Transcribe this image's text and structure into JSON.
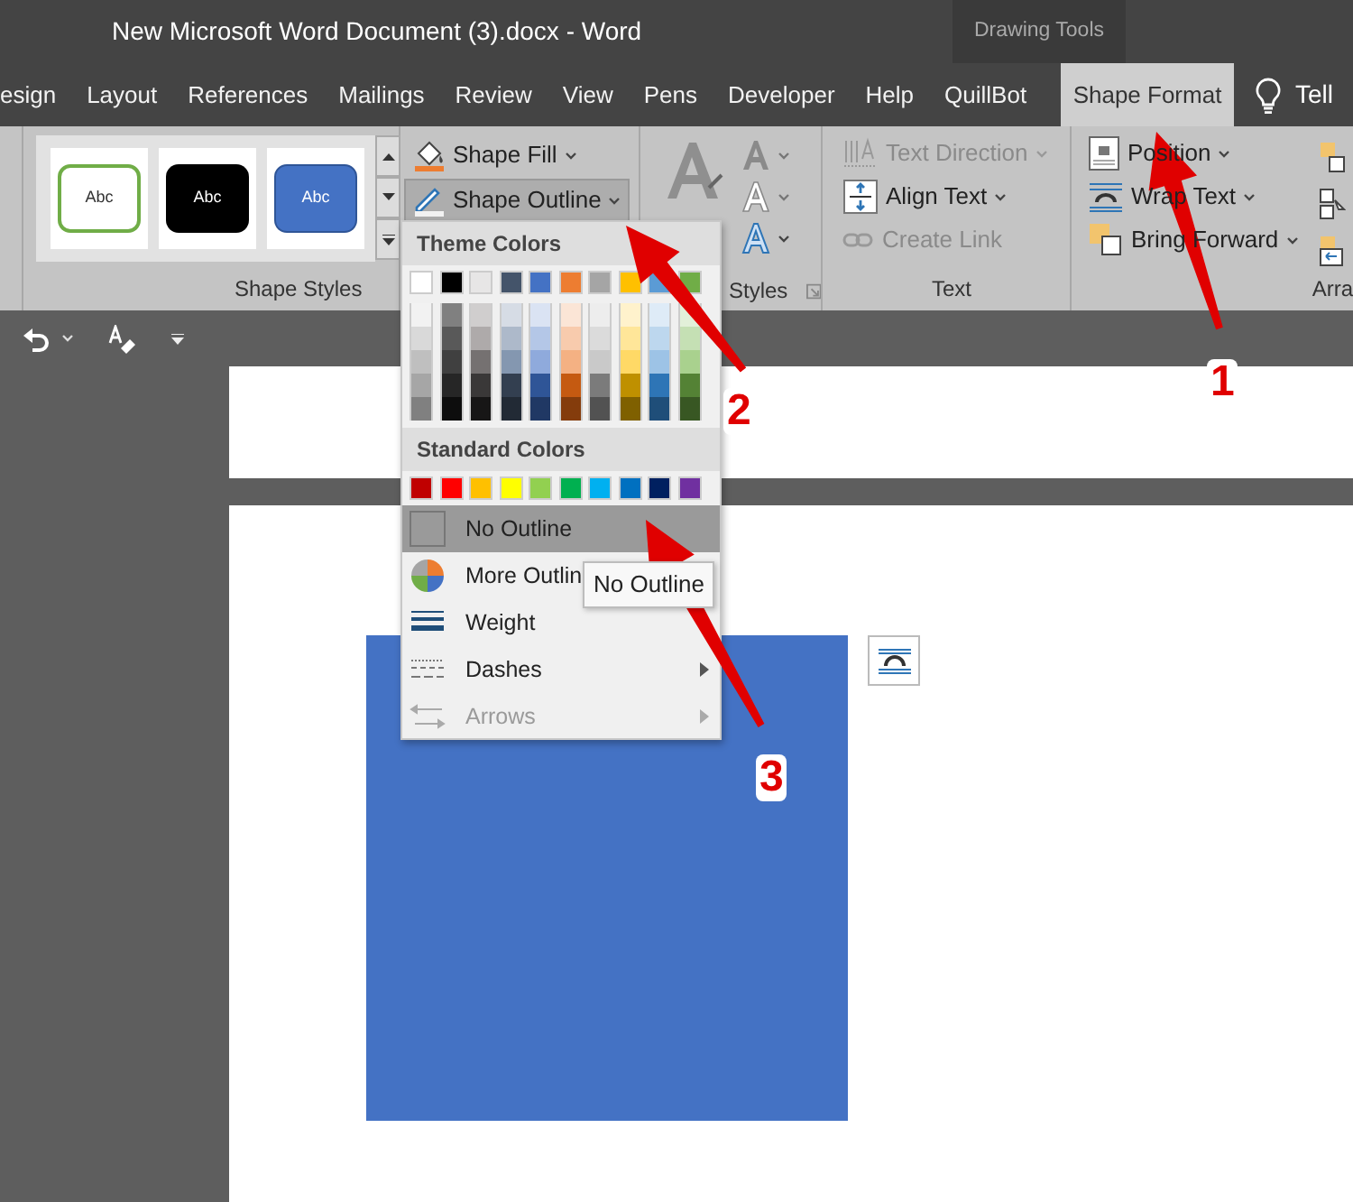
{
  "window": {
    "title": "New Microsoft Word Document (3).docx  -  Word",
    "contextual_group": "Drawing Tools"
  },
  "tabs": [
    {
      "label": "esign",
      "selected": false
    },
    {
      "label": "Layout",
      "selected": false
    },
    {
      "label": "References",
      "selected": false
    },
    {
      "label": "Mailings",
      "selected": false
    },
    {
      "label": "Review",
      "selected": false
    },
    {
      "label": "View",
      "selected": false
    },
    {
      "label": "Pens",
      "selected": false
    },
    {
      "label": "Developer",
      "selected": false
    },
    {
      "label": "Help",
      "selected": false
    },
    {
      "label": "QuillBot",
      "selected": false
    },
    {
      "label": "Shape Format",
      "selected": true
    }
  ],
  "tell_me": "Tell",
  "shape_styles": {
    "label": "Shape Styles",
    "thumbnails": [
      {
        "label": "Abc",
        "kind": "outline"
      },
      {
        "label": "Abc",
        "kind": "black"
      },
      {
        "label": "Abc",
        "kind": "blue"
      }
    ]
  },
  "shape_buttons": [
    {
      "label": "Shape Fill",
      "kind": "fill",
      "selected": false
    },
    {
      "label": "Shape Outline",
      "kind": "outline",
      "selected": true
    }
  ],
  "wordart_group": {
    "label": "Styles"
  },
  "text_group": {
    "label": "Text",
    "items": [
      {
        "label": "Text Direction",
        "kind": "direction",
        "disabled": true
      },
      {
        "label": "Align Text",
        "kind": "align",
        "disabled": false
      },
      {
        "label": "Create Link",
        "kind": "link",
        "disabled": true
      }
    ]
  },
  "arrange_group": {
    "label": "Arra",
    "items": [
      {
        "label": "Position",
        "kind": "position"
      },
      {
        "label": "Wrap Text",
        "kind": "wrap"
      },
      {
        "label": "Bring Forward",
        "kind": "forward"
      }
    ]
  },
  "outline_menu": {
    "theme_header": "Theme Colors",
    "theme_colors": [
      {
        "color": "#ffffff",
        "shades": [
          {
            "color": "#f2f2f2"
          },
          {
            "color": "#d9d9d9"
          },
          {
            "color": "#bfbfbf"
          },
          {
            "color": "#a6a6a6"
          },
          {
            "color": "#808080"
          }
        ]
      },
      {
        "color": "#000000",
        "shades": [
          {
            "color": "#808080"
          },
          {
            "color": "#595959"
          },
          {
            "color": "#404040"
          },
          {
            "color": "#262626"
          },
          {
            "color": "#0d0d0d"
          }
        ]
      },
      {
        "color": "#e7e6e6",
        "shades": [
          {
            "color": "#d0cece"
          },
          {
            "color": "#aeaaaa"
          },
          {
            "color": "#757171"
          },
          {
            "color": "#3a3838"
          },
          {
            "color": "#171616"
          }
        ]
      },
      {
        "color": "#44546a",
        "shades": [
          {
            "color": "#d6dce5"
          },
          {
            "color": "#adb9ca"
          },
          {
            "color": "#8497b0"
          },
          {
            "color": "#333f50"
          },
          {
            "color": "#222a35"
          }
        ]
      },
      {
        "color": "#4472c4",
        "shades": [
          {
            "color": "#dae3f3"
          },
          {
            "color": "#b4c7e7"
          },
          {
            "color": "#8faadc"
          },
          {
            "color": "#2f5597"
          },
          {
            "color": "#203864"
          }
        ]
      },
      {
        "color": "#ed7d31",
        "shades": [
          {
            "color": "#fbe5d6"
          },
          {
            "color": "#f8cbad"
          },
          {
            "color": "#f4b183"
          },
          {
            "color": "#c55a11"
          },
          {
            "color": "#843c0c"
          }
        ]
      },
      {
        "color": "#a5a5a5",
        "shades": [
          {
            "color": "#ededed"
          },
          {
            "color": "#dbdbdb"
          },
          {
            "color": "#c9c9c9"
          },
          {
            "color": "#7b7b7b"
          },
          {
            "color": "#525252"
          }
        ]
      },
      {
        "color": "#ffc000",
        "shades": [
          {
            "color": "#fff2cc"
          },
          {
            "color": "#ffe699"
          },
          {
            "color": "#ffd966"
          },
          {
            "color": "#bf9000"
          },
          {
            "color": "#7f6000"
          }
        ]
      },
      {
        "color": "#5b9bd5",
        "shades": [
          {
            "color": "#deebf7"
          },
          {
            "color": "#bdd7ee"
          },
          {
            "color": "#9dc3e6"
          },
          {
            "color": "#2e75b6"
          },
          {
            "color": "#1f4e79"
          }
        ]
      },
      {
        "color": "#70ad47",
        "shades": [
          {
            "color": "#e2f0d9"
          },
          {
            "color": "#c5e0b4"
          },
          {
            "color": "#a9d18e"
          },
          {
            "color": "#548235"
          },
          {
            "color": "#385723"
          }
        ]
      }
    ],
    "standard_header": "Standard Colors",
    "standard_colors": [
      {
        "color": "#c00000"
      },
      {
        "color": "#ff0000"
      },
      {
        "color": "#ffc000"
      },
      {
        "color": "#ffff00"
      },
      {
        "color": "#92d050"
      },
      {
        "color": "#00b050"
      },
      {
        "color": "#00b0f0"
      },
      {
        "color": "#0070c0"
      },
      {
        "color": "#002060"
      },
      {
        "color": "#7030a0"
      }
    ],
    "items": [
      {
        "label": "No Outline",
        "kind": "none",
        "selected": true,
        "disabled": false
      },
      {
        "label": "More Outlin",
        "kind": "more",
        "selected": false,
        "disabled": false
      },
      {
        "label": "Weight",
        "kind": "weight",
        "selected": false,
        "disabled": false
      },
      {
        "label": "Dashes",
        "kind": "dashes",
        "selected": false,
        "disabled": false
      },
      {
        "label": "Arrows",
        "kind": "arrows",
        "selected": false,
        "disabled": true
      }
    ]
  },
  "tooltip": "No Outline",
  "annotations": [
    {
      "label": "1"
    },
    {
      "label": "2"
    },
    {
      "label": "3"
    }
  ]
}
